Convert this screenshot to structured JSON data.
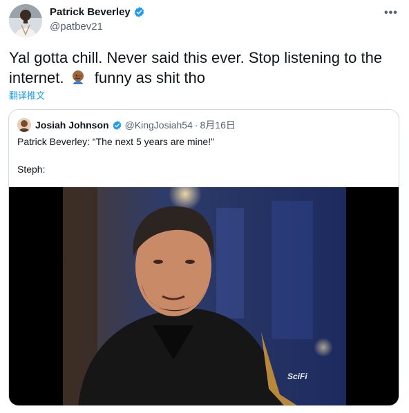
{
  "author": {
    "display_name": "Patrick Beverley",
    "handle": "@patbev21",
    "verified": true
  },
  "tweet": {
    "text_part1": "Yal gotta chill. Never said this ever. Stop listening to the internet.",
    "emoji": "facepalm-emoji",
    "text_part2": "funny as shit tho",
    "translate_label": "翻译推文"
  },
  "menu": {
    "more_label": "•••"
  },
  "quoted_tweet": {
    "display_name": "Josiah Johnson",
    "handle": "@KingJosiah54",
    "separator": "·",
    "date": "8月16日",
    "verified": true,
    "line1": "Patrick Beverley: “The next 5 years are mine!”",
    "line2": "Steph:",
    "media_watermark": "SciFi"
  },
  "colors": {
    "verified_blue": "#1d9bf0",
    "link_blue": "#1d9bf0",
    "secondary_text": "#536471",
    "border": "#cfd9de"
  }
}
